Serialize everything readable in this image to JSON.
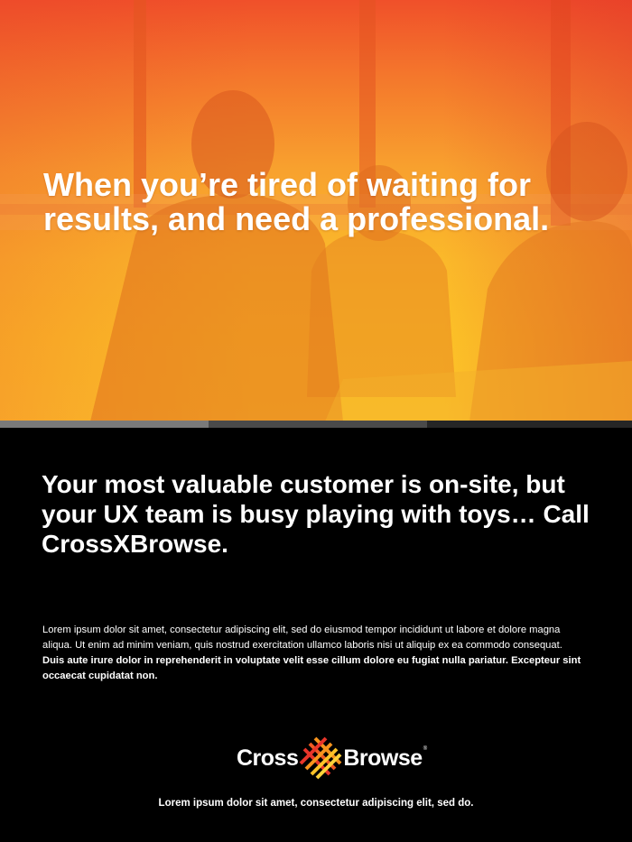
{
  "hero": {
    "headline": "When you’re tired of waiting for results, and need a professional."
  },
  "section": {
    "subhead": "Your most valuable customer is on-site, but your UX team is busy playing with toys… Call CrossXBrowse.",
    "body_regular": "Lorem ipsum dolor sit amet, consectetur adipiscing elit, sed do eiusmod tempor incididunt ut labore et dolore magna aliqua. Ut enim ad minim veniam, quis nostrud exercitation ullamco laboris nisi ut aliquip ex ea commodo consequat. ",
    "body_bold": "Duis aute irure dolor in reprehenderit in voluptate velit esse cillum dolore eu fugiat nulla pariatur. Excepteur sint occaecat cupidatat non."
  },
  "logo": {
    "word_left": "Cross",
    "word_right": "Browse",
    "trademark": "®",
    "icon": "crosshatch-x-logo-icon"
  },
  "footer": {
    "tagline": "Lorem ipsum dolor sit amet, consectetur adipiscing elit, sed do."
  },
  "colors": {
    "hero_top": "#f0502a",
    "hero_bottom": "#fdc52a",
    "background": "#000000",
    "logo_red": "#e8352a",
    "logo_orange": "#f7941d",
    "logo_yellow": "#fcc227"
  }
}
